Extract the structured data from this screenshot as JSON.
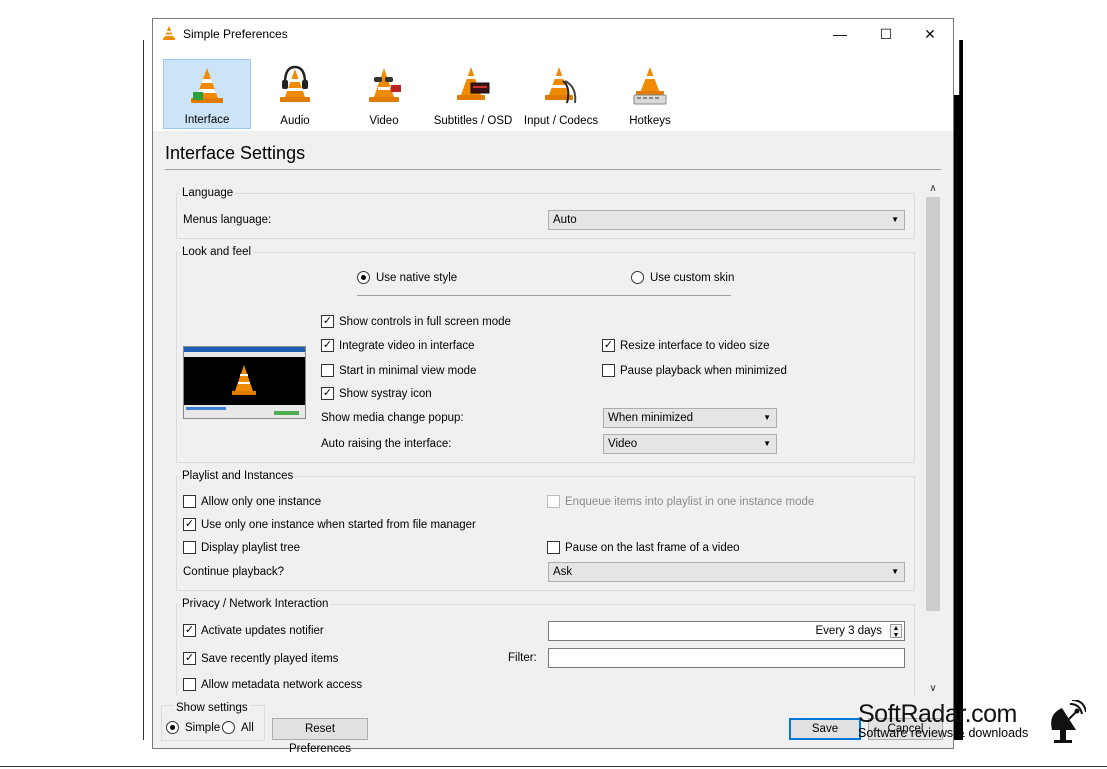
{
  "window": {
    "title": "Simple Preferences"
  },
  "titlebar": {
    "minimize": "—",
    "maximize": "☐",
    "close": "✕"
  },
  "categories": [
    {
      "label": "Interface",
      "icon": "vlc-cone-interface-icon",
      "selected": true
    },
    {
      "label": "Audio",
      "icon": "vlc-cone-headphones-icon"
    },
    {
      "label": "Video",
      "icon": "vlc-cone-sunglasses-icon"
    },
    {
      "label": "Subtitles / OSD",
      "icon": "vlc-cone-subtitles-icon"
    },
    {
      "label": "Input / Codecs",
      "icon": "vlc-cone-cables-icon"
    },
    {
      "label": "Hotkeys",
      "icon": "vlc-cone-keyboard-icon"
    }
  ],
  "heading": "Interface Settings",
  "language": {
    "title": "Language",
    "menus_label": "Menus language:",
    "menus_value": "Auto"
  },
  "look": {
    "title": "Look and feel",
    "native_style": "Use native style",
    "custom_skin": "Use custom skin",
    "fullscreen_controls": "Show controls in full screen mode",
    "integrate_video": "Integrate video in interface",
    "minimal_view": "Start in minimal view mode",
    "systray": "Show systray icon",
    "resize_interface": "Resize interface to video size",
    "pause_minimized": "Pause playback when minimized",
    "media_popup_label": "Show media change popup:",
    "media_popup_value": "When minimized",
    "auto_raise_label": "Auto raising the interface:",
    "auto_raise_value": "Video"
  },
  "playlist": {
    "title": "Playlist and Instances",
    "one_instance": "Allow only one instance",
    "enqueue": "Enqueue items into playlist in one instance mode",
    "file_manager": "Use only one instance when started from file manager",
    "playlist_tree": "Display playlist tree",
    "pause_last_frame": "Pause on the last frame of a video",
    "continue_label": "Continue playback?",
    "continue_value": "Ask"
  },
  "privacy": {
    "title": "Privacy / Network Interaction",
    "updates": "Activate updates notifier",
    "updates_value": "Every 3 days",
    "recent": "Save recently played items",
    "filter_label": "Filter:",
    "metadata": "Allow metadata network access"
  },
  "footer": {
    "show_settings": "Show settings",
    "simple": "Simple",
    "all": "All",
    "reset": "Reset Preferences",
    "save": "Save",
    "cancel": "Cancel"
  },
  "watermark": {
    "brand": "SoftRadar.com",
    "tagline": "Software reviews & downloads"
  },
  "colors": {
    "vlc_orange": "#f08a00",
    "selection": "#cce4f7",
    "accent": "#0078d7"
  }
}
